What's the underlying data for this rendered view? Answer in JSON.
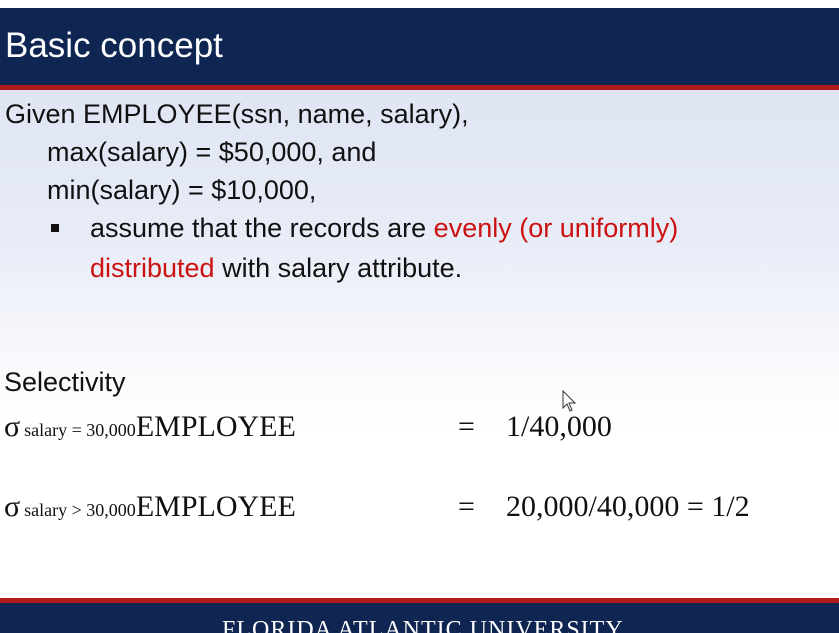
{
  "slide": {
    "title": "Basic concept",
    "given_line": "Given EMPLOYEE(ssn, name, salary),",
    "max_line": "max(salary) = $50,000, and",
    "min_line": "min(salary) = $10,000,",
    "bullet": {
      "text_before": "assume that the records are ",
      "highlight_1": "evenly (or uniformly)",
      "highlight_2": "distributed",
      "text_after": " with salary attribute."
    },
    "selectivity_label": "Selectivity",
    "formulas": [
      {
        "sigma": "σ",
        "condition": "salary = 30,000",
        "relation": "EMPLOYEE",
        "equals": "=",
        "result": "1/40,000"
      },
      {
        "sigma": "σ",
        "condition": "salary > 30,000",
        "relation": "EMPLOYEE",
        "equals": "=",
        "result": "20,000/40,000 = 1/2"
      }
    ],
    "footer_logo": "FLORIDA ATLANTIC UNIVERSITY"
  },
  "colors": {
    "header_bg": "#0f2552",
    "accent_rule": "#b01a1a",
    "highlight_text": "#cc1111"
  }
}
